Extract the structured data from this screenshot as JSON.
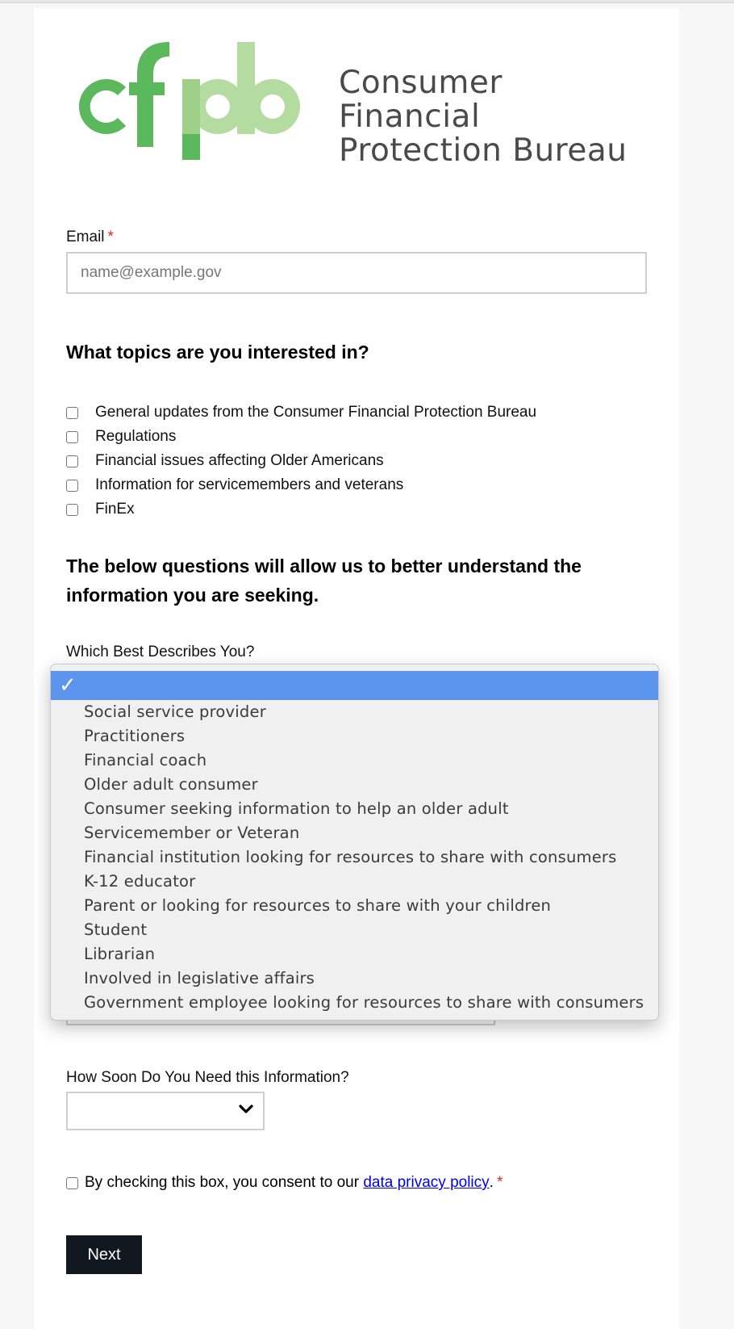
{
  "logo": {
    "mark_text": "cfpb",
    "line1": "Consumer Financial",
    "line2": "Protection Bureau",
    "colors": {
      "dark_green": "#5cb85c",
      "light_green": "#b5dca0",
      "text": "#4a4a4a"
    }
  },
  "email": {
    "label": "Email",
    "required_marker": "*",
    "placeholder": "name@example.gov",
    "value": ""
  },
  "topics": {
    "heading": "What topics are you interested in?",
    "items": [
      {
        "label": "General updates from the Consumer Financial Protection Bureau",
        "checked": false
      },
      {
        "label": "Regulations",
        "checked": false
      },
      {
        "label": "Financial issues affecting Older Americans",
        "checked": false
      },
      {
        "label": "Information for servicemembers and veterans",
        "checked": false
      },
      {
        "label": "FinEx",
        "checked": false
      }
    ]
  },
  "questions": {
    "heading": "The below questions will allow us to better understand the information you are seeking.",
    "describes_label": "Which Best Describes You?",
    "describes_selected": "",
    "describes_options": [
      "Social service provider",
      "Practitioners",
      "Financial coach",
      "Older adult consumer",
      "Consumer seeking information to help an older adult",
      "Servicemember or Veteran",
      "Financial institution looking for resources to share with consumers",
      "K-12 educator",
      "Parent or looking for resources to share with your children",
      "Student",
      "Librarian",
      "Involved in legislative affairs",
      "Government employee looking for resources to share with consumers"
    ],
    "how_soon_label": "How Soon Do You Need this Information?",
    "how_soon_selected": ""
  },
  "consent": {
    "prefix": "By checking this box, you consent to our ",
    "link_text": "data privacy policy",
    "suffix": ".",
    "required_marker": "*",
    "checked": false
  },
  "next_button": {
    "label": "Next"
  },
  "colors": {
    "selected_option_bg": "#5b95ed",
    "button_bg": "#111820",
    "required": "#d62d2d",
    "link": "#0000ee"
  }
}
